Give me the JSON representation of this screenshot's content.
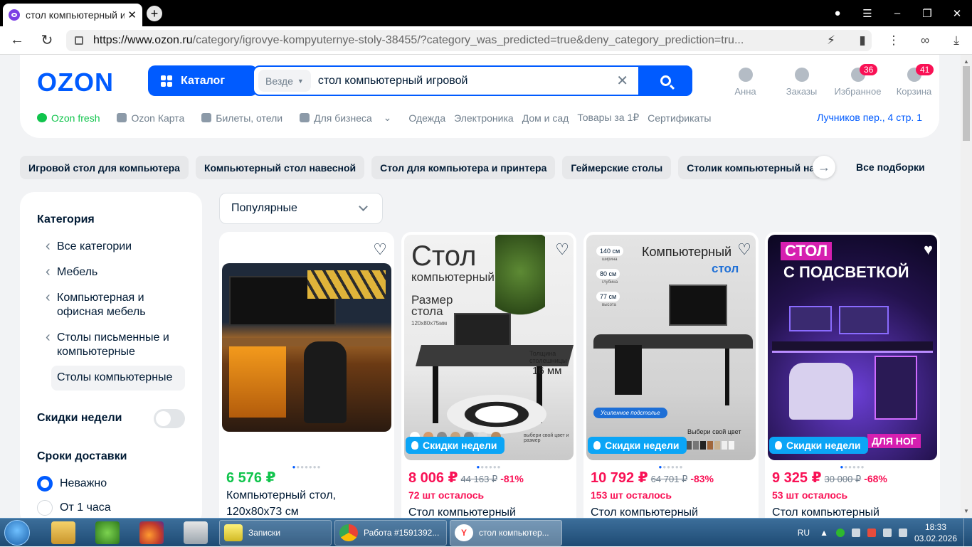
{
  "browser": {
    "tab_title": "стол компьютерный иг",
    "url_host": "https://www.ozon.ru",
    "url_path": "/category/igrovye-kompyuternye-stoly-38455/?category_was_predicted=true&deny_category_prediction=tru..."
  },
  "header": {
    "logo": "OZON",
    "catalog_label": "Каталог",
    "search_scope": "Везде",
    "search_query": "стол компьютерный игровой",
    "icons": [
      {
        "label": "Анна",
        "badge": ""
      },
      {
        "label": "Заказы",
        "badge": ""
      },
      {
        "label": "Избранное",
        "badge": "36"
      },
      {
        "label": "Корзина",
        "badge": "41"
      }
    ],
    "subnav": [
      "Ozon fresh",
      "Ozon Карта",
      "Билеты, отели",
      "Для бизнеса",
      "Одежда",
      "Электроника",
      "Дом и сад",
      "Товары за 1₽",
      "Сертификаты"
    ],
    "address": "Лучников пер., 4 стр. 1"
  },
  "chips": [
    "Игровой стол для компьютера",
    "Компьютерный стол навесной",
    "Стол для компьютера и принтера",
    "Геймерские столы",
    "Столик компьютерный на колесиках"
  ],
  "all_selections": "Все подборки",
  "sidebar": {
    "category_title": "Категория",
    "items": [
      "Все категории",
      "Мебель",
      "Компьютерная и офисная мебель",
      "Столы письменные и компьютерные"
    ],
    "current": "Столы компьютерные",
    "discounts_label": "Скидки недели",
    "delivery_title": "Сроки доставки",
    "delivery_options": [
      "Неважно",
      "От 1 часа"
    ]
  },
  "sort": {
    "value": "Популярные"
  },
  "promo_label": "Скидки недели",
  "products": [
    {
      "price": "6 576 ₽",
      "old": "",
      "pct": "",
      "left": "",
      "name1": "Компьютерный стол,",
      "name2": "120х80х73 см"
    },
    {
      "price": "8 006 ₽",
      "old": "44 163 ₽",
      "pct": "-81%",
      "left": "72 шт осталось",
      "name1": "Стол компьютерный",
      "name2": ""
    },
    {
      "price": "10 792 ₽",
      "old": "64 701 ₽",
      "pct": "-83%",
      "left": "153 шт осталось",
      "name1": "Стол компьютерный",
      "name2": ""
    },
    {
      "price": "9 325 ₽",
      "old": "30 000 ₽",
      "pct": "-68%",
      "left": "53 шт осталось",
      "name1": "Стол компьютерный",
      "name2": ""
    }
  ],
  "image_text": {
    "p2_title": "Стол",
    "p2_sub": "компьютерный",
    "p2_size_title": "Размер",
    "p2_size_title2": "стола",
    "p2_size": "120х80х75мм",
    "p2_thick": "Толщина",
    "p2_thick2": "столешницы",
    "p2_mm": "16 мм",
    "p2_colors": "выбери свой цвет и размер",
    "p3_title": "Компьютерный",
    "p3_sub": "стол",
    "p3_d1": "140 см",
    "p3_d1l": "ширина",
    "p3_d2": "80 см",
    "p3_d2l": "глубина",
    "p3_d3": "77 см",
    "p3_d3l": "высота",
    "p3_pill": "Усиленное подстолье",
    "p3_color": "Выбери свой цвет",
    "p4_t1": "СТОЛ",
    "p4_t2": "С ПОДСВЕТКОЙ",
    "p4_tag": "ДЛЯ НОГ"
  },
  "taskbar": {
    "tasks": [
      "Записки",
      "Работа #1591392...",
      "стол компьютер..."
    ],
    "lang": "RU",
    "time": "18:33",
    "date": "03.02.2026"
  },
  "colors": {
    "accent": "#005bff",
    "green": "#10c44c",
    "pink": "#f91155",
    "promo": "#0ba5f6"
  }
}
